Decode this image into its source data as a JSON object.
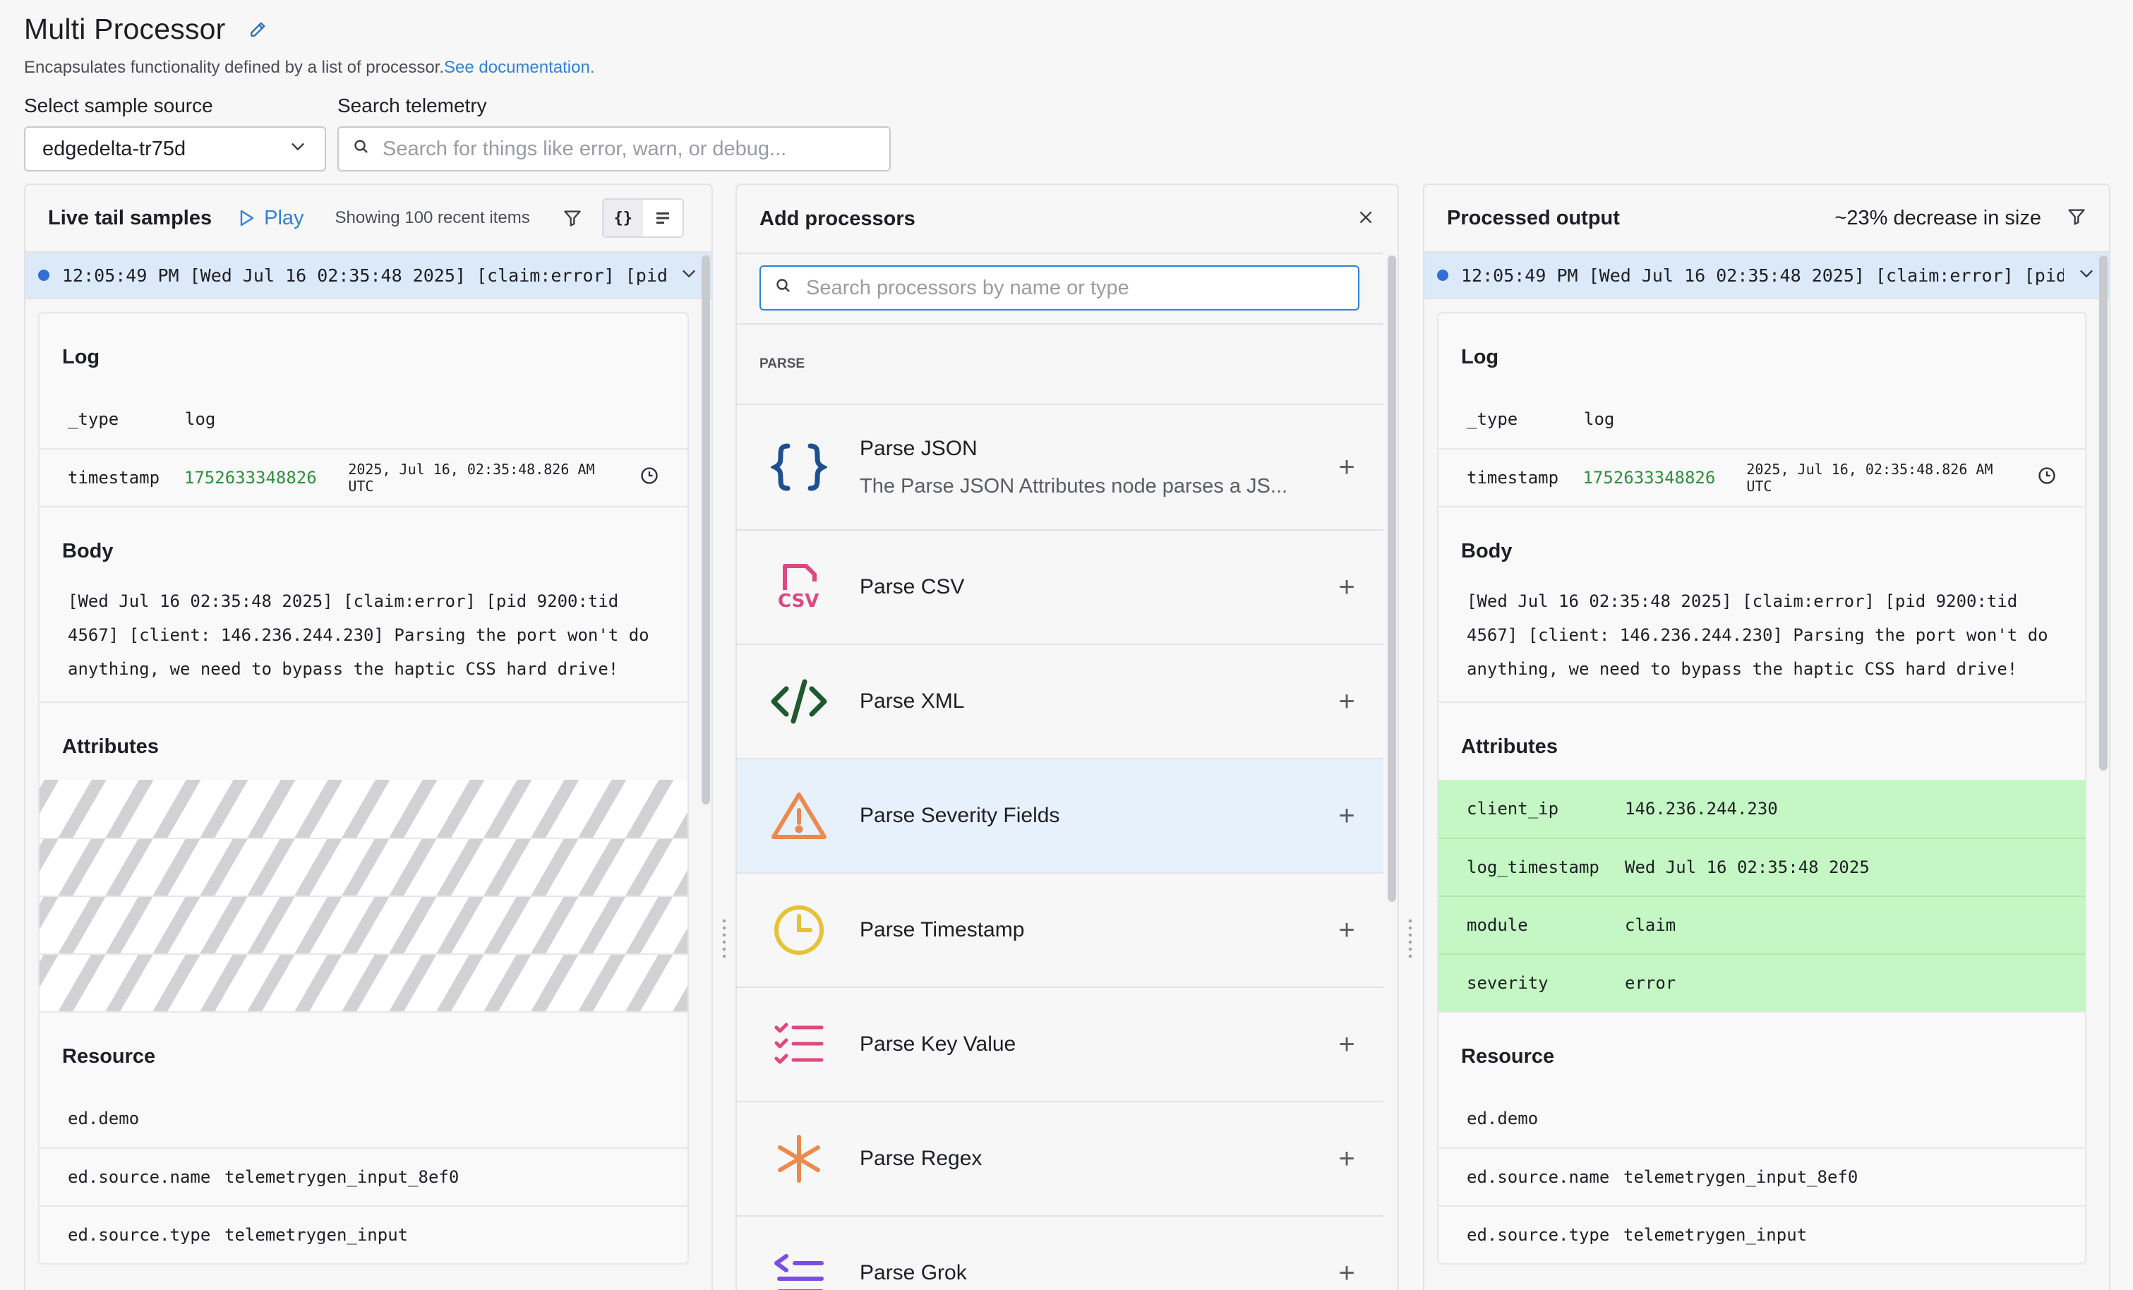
{
  "header": {
    "title": "Multi Processor",
    "description": "Encapsulates functionality defined by a list of processor.",
    "doc_link": "See documentation."
  },
  "controls": {
    "sample_source_label": "Select sample source",
    "sample_source_value": "edgedelta-tr75d",
    "search_label": "Search telemetry",
    "search_placeholder": "Search for things like error, warn, or debug..."
  },
  "left_panel": {
    "title": "Live tail samples",
    "play_label": "Play",
    "showing": "Showing 100 recent items",
    "view_json": "{}",
    "log_line": "12:05:49 PM [Wed Jul 16 02:35:48 2025] [claim:error] [pid…",
    "log_section": "Log",
    "type_key": "_type",
    "type_val": "log",
    "timestamp_key": "timestamp",
    "timestamp_val": "1752633348826",
    "timestamp_date": "2025, Jul 16, 02:35:48.826 AM UTC",
    "body_section": "Body",
    "body_text": "[Wed Jul 16 02:35:48 2025] [claim:error] [pid 9200:tid 4567] [client: 146.236.244.230] Parsing the port won't do anything, we need to bypass the haptic CSS hard drive!",
    "attributes_section": "Attributes",
    "resource_section": "Resource",
    "resources": [
      {
        "k": "ed.demo",
        "v": ""
      },
      {
        "k": "ed.source.name",
        "v": "telemetrygen_input_8ef0"
      },
      {
        "k": "ed.source.type",
        "v": "telemetrygen_input"
      }
    ]
  },
  "middle_panel": {
    "title": "Add processors",
    "search_placeholder": "Search processors by name or type",
    "section": "PARSE",
    "processors": [
      {
        "name": "Parse JSON",
        "desc": "The Parse JSON Attributes node parses a JS..."
      },
      {
        "name": "Parse CSV"
      },
      {
        "name": "Parse XML"
      },
      {
        "name": "Parse Severity Fields"
      },
      {
        "name": "Parse Timestamp"
      },
      {
        "name": "Parse Key Value"
      },
      {
        "name": "Parse Regex"
      },
      {
        "name": "Parse Grok"
      }
    ],
    "csv_icon_text": "CSV",
    "plus": "+"
  },
  "right_panel": {
    "title": "Processed output",
    "size_change": "~23% decrease in size",
    "log_line": "12:05:49 PM [Wed Jul 16 02:35:48 2025] [claim:error] [pid…",
    "attributes": [
      {
        "k": "client_ip",
        "v": "146.236.244.230"
      },
      {
        "k": "log_timestamp",
        "v": "Wed Jul 16 02:35:48 2025"
      },
      {
        "k": "module",
        "v": "claim"
      },
      {
        "k": "severity",
        "v": "error"
      }
    ]
  },
  "colors": {
    "accent": "#2f82d4",
    "highlight": "#e7f1fb",
    "added_attr": "#c4f7c3",
    "timestamp_green": "#2e8f3d"
  }
}
